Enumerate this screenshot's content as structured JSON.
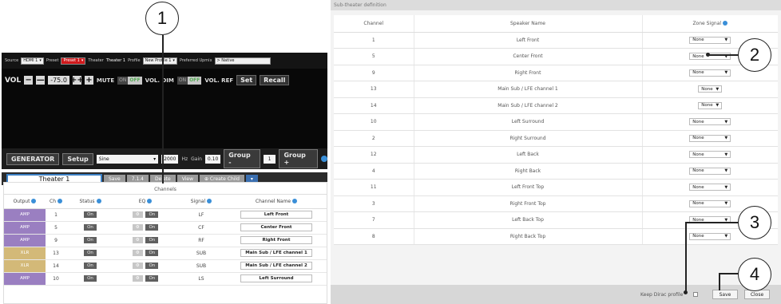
{
  "left": {
    "topbar": {
      "source_label": "Source",
      "source_value": "HDMI 1",
      "preset_label": "Preset",
      "preset_value": "Preset 1",
      "theater_label": "Theater",
      "theater_value": "Theater 1",
      "profile_label": "Profile",
      "profile_value": "New Profile 1",
      "upmix_label": "Preferred Upmix",
      "upmix_value": "> Native"
    },
    "vol": {
      "label": "VOL",
      "minus": "−",
      "minus2": "—",
      "value": "-75.0",
      "plus2": "++",
      "plus": "+",
      "mute_label": "MUTE",
      "dim_label": "VOL. DIM",
      "on": "ON",
      "off": "OFF",
      "ref_label": "VOL. REF",
      "set": "Set",
      "recall": "Recall"
    },
    "generator": {
      "label": "GENERATOR",
      "setup": "Setup",
      "signal": "Sine",
      "freq": "2000",
      "hz": "Hz",
      "gain_label": "Gain",
      "gain": "0.10",
      "group_minus": "Group -",
      "group_value": "1",
      "group_plus": "Group +"
    },
    "theater_bar": {
      "name": "Theater 1",
      "save": "Save",
      "info": "7.1.4",
      "delete": "Delete",
      "view": "View",
      "create_child": "Create Child"
    },
    "channels": {
      "title": "Channels",
      "headers": [
        "Output",
        "Ch",
        "Status",
        "EQ",
        "Signal",
        "Channel Name"
      ],
      "rows": [
        {
          "output": "AMP",
          "type": "amp",
          "ch": "1",
          "status": "On",
          "eq": "On",
          "signal": "LF",
          "name": "Left Front"
        },
        {
          "output": "AMP",
          "type": "amp",
          "ch": "5",
          "status": "On",
          "eq": "On",
          "signal": "CF",
          "name": "Center Front"
        },
        {
          "output": "AMP",
          "type": "amp",
          "ch": "9",
          "status": "On",
          "eq": "On",
          "signal": "RF",
          "name": "Right Front"
        },
        {
          "output": "XLR",
          "type": "xlr",
          "ch": "13",
          "status": "On",
          "eq": "On",
          "signal": "SUB",
          "name": "Main Sub / LFE channel 1"
        },
        {
          "output": "XLR",
          "type": "xlr",
          "ch": "14",
          "status": "On",
          "eq": "On",
          "signal": "SUB",
          "name": "Main Sub / LFE channel 2"
        },
        {
          "output": "AMP",
          "type": "amp",
          "ch": "10",
          "status": "On",
          "eq": "On",
          "signal": "LS",
          "name": "Left Surround"
        }
      ]
    }
  },
  "right": {
    "title": "Sub-theater definition",
    "headers": [
      "Channel",
      "Speaker Name",
      "Zone Signal"
    ],
    "rows": [
      {
        "channel": "1",
        "speaker": "Left Front",
        "zone": "None"
      },
      {
        "channel": "5",
        "speaker": "Center Front",
        "zone": "None"
      },
      {
        "channel": "9",
        "speaker": "Right Front",
        "zone": "None"
      },
      {
        "channel": "13",
        "speaker": "Main Sub / LFE channel 1",
        "zone": "None",
        "short": true
      },
      {
        "channel": "14",
        "speaker": "Main Sub / LFE channel 2",
        "zone": "None",
        "short": true
      },
      {
        "channel": "10",
        "speaker": "Left Surround",
        "zone": "None"
      },
      {
        "channel": "2",
        "speaker": "Right Surround",
        "zone": "None"
      },
      {
        "channel": "12",
        "speaker": "Left Back",
        "zone": "None"
      },
      {
        "channel": "4",
        "speaker": "Right Back",
        "zone": "None"
      },
      {
        "channel": "11",
        "speaker": "Left Front Top",
        "zone": "None"
      },
      {
        "channel": "3",
        "speaker": "Right Front Top",
        "zone": "None"
      },
      {
        "channel": "7",
        "speaker": "Left Back Top",
        "zone": "None"
      },
      {
        "channel": "8",
        "speaker": "Right Back Top",
        "zone": "None"
      }
    ],
    "footer": {
      "keep_label": "Keep Dirac profile",
      "save": "Save",
      "close": "Close"
    }
  },
  "callouts": [
    "1",
    "2",
    "3",
    "4"
  ]
}
